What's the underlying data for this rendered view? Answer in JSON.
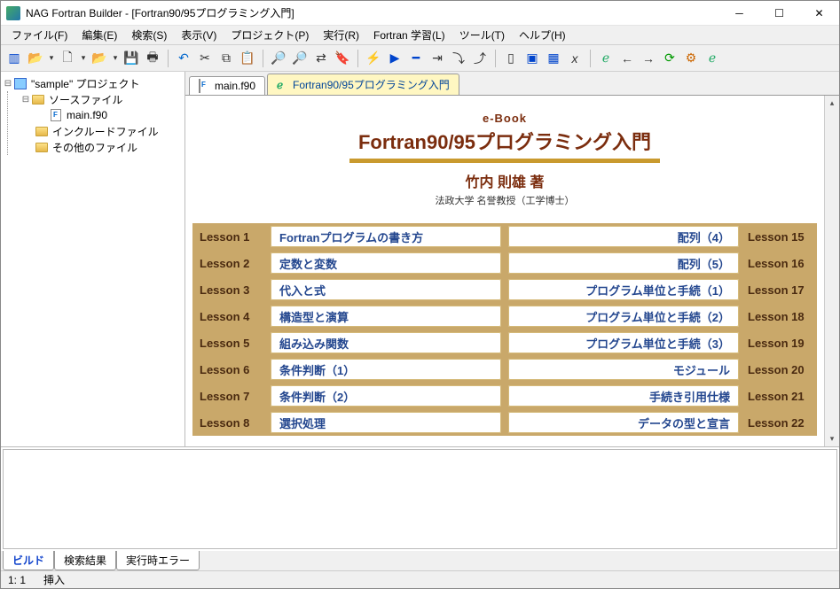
{
  "window": {
    "title": "NAG Fortran Builder - [Fortran90/95プログラミング入門]"
  },
  "menu": {
    "file": "ファイル(F)",
    "edit": "編集(E)",
    "search": "検索(S)",
    "view": "表示(V)",
    "project": "プロジェクト(P)",
    "run": "実行(R)",
    "learn": "Fortran 学習(L)",
    "tools": "ツール(T)",
    "help": "ヘルプ(H)"
  },
  "tree": {
    "project": "\"sample\" プロジェクト",
    "source_folder": "ソースファイル",
    "main_file": "main.f90",
    "include_folder": "インクルードファイル",
    "other_folder": "その他のファイル"
  },
  "tabs": {
    "file": "main.f90",
    "ebook": "Fortran90/95プログラミング入門"
  },
  "ebook": {
    "label": "e-Book",
    "title": "Fortran90/95プログラミング入門",
    "author": "竹内 則雄 著",
    "affiliation": "法政大学 名誉教授（工学博士）",
    "left": [
      {
        "num": "Lesson 1",
        "title": "Fortranプログラムの書き方"
      },
      {
        "num": "Lesson 2",
        "title": "定数と変数"
      },
      {
        "num": "Lesson 3",
        "title": "代入と式"
      },
      {
        "num": "Lesson 4",
        "title": "構造型と演算"
      },
      {
        "num": "Lesson 5",
        "title": "組み込み関数"
      },
      {
        "num": "Lesson 6",
        "title": "条件判断（1）"
      },
      {
        "num": "Lesson 7",
        "title": "条件判断（2）"
      },
      {
        "num": "Lesson 8",
        "title": "選択処理"
      }
    ],
    "right": [
      {
        "num": "Lesson 15",
        "title": "配列（4）"
      },
      {
        "num": "Lesson 16",
        "title": "配列（5）"
      },
      {
        "num": "Lesson 17",
        "title": "プログラム単位と手続（1）"
      },
      {
        "num": "Lesson 18",
        "title": "プログラム単位と手続（2）"
      },
      {
        "num": "Lesson 19",
        "title": "プログラム単位と手続（3）"
      },
      {
        "num": "Lesson 20",
        "title": "モジュール"
      },
      {
        "num": "Lesson 21",
        "title": "手続き引用仕様"
      },
      {
        "num": "Lesson 22",
        "title": "データの型と宣言"
      }
    ]
  },
  "bottom_tabs": {
    "build": "ビルド",
    "results": "検索結果",
    "errors": "実行時エラー"
  },
  "status": {
    "pos": "1:   1",
    "mode": "挿入"
  }
}
